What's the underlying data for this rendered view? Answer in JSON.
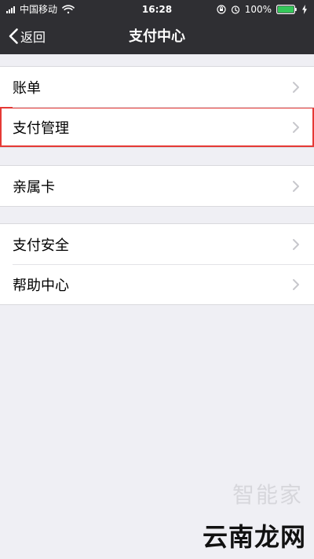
{
  "status_bar": {
    "carrier": "中国移动",
    "time": "16:28",
    "battery": "100%"
  },
  "nav": {
    "back_label": "返回",
    "title": "支付中心"
  },
  "groups": [
    {
      "items": [
        {
          "label": "账单"
        },
        {
          "label": "支付管理"
        }
      ]
    },
    {
      "items": [
        {
          "label": "亲属卡"
        }
      ]
    },
    {
      "items": [
        {
          "label": "支付安全"
        },
        {
          "label": "帮助中心"
        }
      ]
    }
  ],
  "watermark": {
    "brand": "云南龙网",
    "faint": "智能家"
  }
}
